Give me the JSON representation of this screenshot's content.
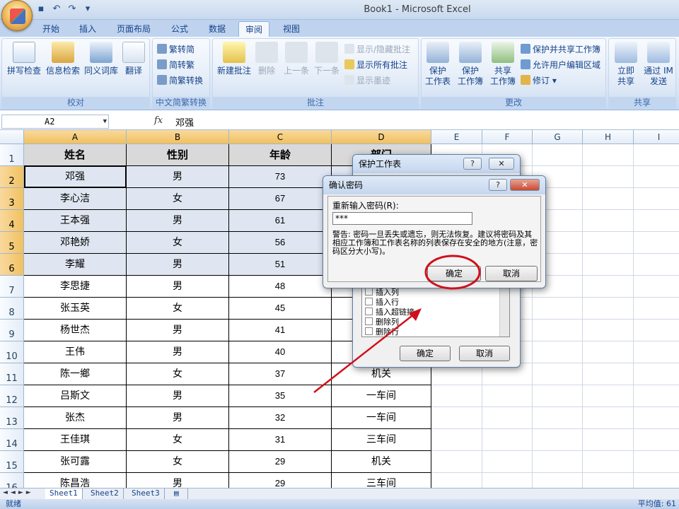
{
  "window": {
    "title": "Book1 - Microsoft Excel"
  },
  "tabs": [
    {
      "label": "开始"
    },
    {
      "label": "插入"
    },
    {
      "label": "页面布局"
    },
    {
      "label": "公式"
    },
    {
      "label": "数据"
    },
    {
      "label": "审阅"
    },
    {
      "label": "视图"
    }
  ],
  "active_tab": "审阅",
  "ribbon": {
    "proofing": {
      "label": "校对",
      "spell": "拼写检查",
      "research": "信息检索",
      "thesaurus": "同义词库",
      "translate": "翻译"
    },
    "chinese": {
      "label": "中文简繁转换",
      "t2s": "繁转简",
      "s2t": "简转繁",
      "convert": "简繁转换"
    },
    "comments": {
      "label": "批注",
      "new": "新建批注",
      "delete": "删除",
      "prev": "上一条",
      "next": "下一条",
      "show_hide": "显示/隐藏批注",
      "show_all": "显示所有批注",
      "show_ink": "显示墨迹"
    },
    "changes": {
      "label": "更改",
      "protect_sheet": "保护\n工作表",
      "protect_book": "保护\n工作簿",
      "share_book": "共享\n工作簿",
      "protect_share": "保护并共享工作簿",
      "allow_edit": "允许用户编辑区域",
      "track": "修订"
    },
    "share": {
      "label": "共享",
      "im_share": "立即\n共享",
      "im_send": "通过 IM\n发送"
    }
  },
  "formula_bar": {
    "name_box": "A2",
    "fx": "fx",
    "value": "邓强"
  },
  "columns": [
    "A",
    "B",
    "C",
    "D",
    "E",
    "F",
    "G",
    "H",
    "I"
  ],
  "header_row": [
    "姓名",
    "性别",
    "年龄",
    "部门"
  ],
  "rows": [
    {
      "n": "2",
      "name": "邓强",
      "sex": "男",
      "age": "73",
      "dept": ""
    },
    {
      "n": "3",
      "name": "李心洁",
      "sex": "女",
      "age": "67",
      "dept": ""
    },
    {
      "n": "4",
      "name": "王本强",
      "sex": "男",
      "age": "61",
      "dept": ""
    },
    {
      "n": "5",
      "name": "邓艳娇",
      "sex": "女",
      "age": "56",
      "dept": ""
    },
    {
      "n": "6",
      "name": "李耀",
      "sex": "男",
      "age": "51",
      "dept": ""
    },
    {
      "n": "7",
      "name": "李思捷",
      "sex": "男",
      "age": "48",
      "dept": ""
    },
    {
      "n": "8",
      "name": "张玉英",
      "sex": "女",
      "age": "45",
      "dept": ""
    },
    {
      "n": "9",
      "name": "杨世杰",
      "sex": "男",
      "age": "41",
      "dept": ""
    },
    {
      "n": "10",
      "name": "王伟",
      "sex": "男",
      "age": "40",
      "dept": ""
    },
    {
      "n": "11",
      "name": "陈一鄉",
      "sex": "女",
      "age": "37",
      "dept": "机关"
    },
    {
      "n": "12",
      "name": "吕斯文",
      "sex": "男",
      "age": "35",
      "dept": "一车间"
    },
    {
      "n": "13",
      "name": "张杰",
      "sex": "男",
      "age": "32",
      "dept": "一车间"
    },
    {
      "n": "14",
      "name": "王佳琪",
      "sex": "女",
      "age": "31",
      "dept": "三车间"
    },
    {
      "n": "15",
      "name": "张可露",
      "sex": "女",
      "age": "29",
      "dept": "机关"
    },
    {
      "n": "16",
      "name": "陈昌浩",
      "sex": "男",
      "age": "29",
      "dept": "三车间"
    }
  ],
  "sheets": [
    "Sheet1",
    "Sheet2",
    "Sheet3"
  ],
  "status": {
    "left": "就绪",
    "right": "平均值: 61"
  },
  "protect_dialog": {
    "title": "保护工作表",
    "help": "?",
    "items": [
      "插入列",
      "插入行",
      "插入超链接",
      "删除列",
      "删除行"
    ],
    "ok": "确定",
    "cancel": "取消"
  },
  "confirm_dialog": {
    "title": "确认密码",
    "help": "?",
    "prompt": "重新输入密码(R):",
    "password": "***",
    "warning": "警告: 密码一旦丢失或遗忘，则无法恢复。建议将密码及其相应工作簿和工作表名称的列表保存在安全的地方(注意，密码区分大小写)。",
    "ok": "确定",
    "cancel": "取消"
  },
  "colors": {
    "accent_red": "#d0101c",
    "ribbon_blue": "#15428b"
  }
}
